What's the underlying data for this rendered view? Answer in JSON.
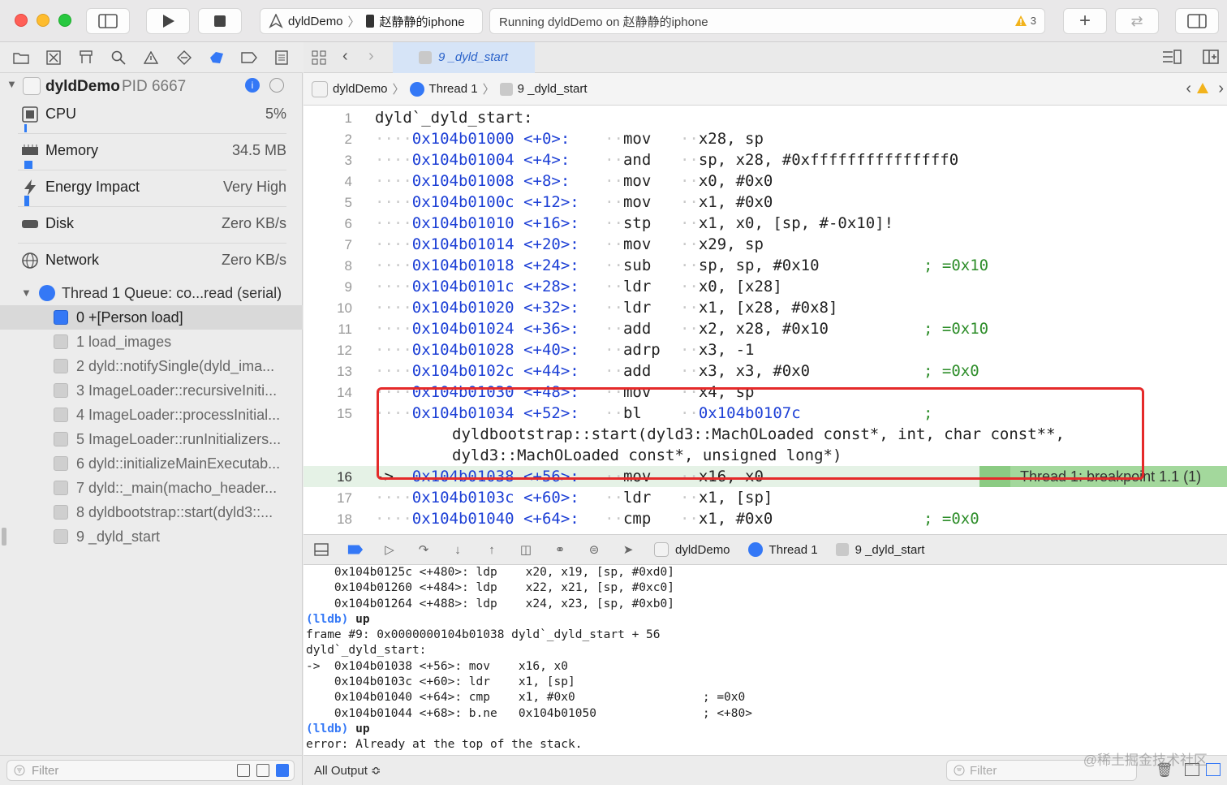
{
  "toolbar": {
    "scheme_project": "dyldDemo",
    "scheme_device": "赵静静的iphone",
    "activity_text": "Running dyldDemo on 赵静静的iphone",
    "warning_count": "3"
  },
  "navigator": {
    "process_name": "dyldDemo",
    "process_pid": "PID 6667",
    "gauges": [
      {
        "label": "CPU",
        "value": "5%"
      },
      {
        "label": "Memory",
        "value": "34.5 MB"
      },
      {
        "label": "Energy Impact",
        "value": "Very High"
      },
      {
        "label": "Disk",
        "value": "Zero KB/s"
      },
      {
        "label": "Network",
        "value": "Zero KB/s"
      }
    ],
    "thread_label": "Thread 1 Queue: co...read (serial)",
    "frames": [
      "0 +[Person load]",
      "1 load_images",
      "2 dyld::notifySingle(dyld_ima...",
      "3 ImageLoader::recursiveIniti...",
      "4 ImageLoader::processInitial...",
      "5 ImageLoader::runInitializers...",
      "6 dyld::initializeMainExecutab...",
      "7 dyld::_main(macho_header...",
      "8 dyldbootstrap::start(dyld3::...",
      "9 _dyld_start"
    ],
    "filter_placeholder": "Filter"
  },
  "editor": {
    "tab_label": "9 _dyld_start",
    "jump": {
      "project": "dyldDemo",
      "thread": "Thread 1",
      "frame": "9 _dyld_start"
    },
    "header": "dyld`_dyld_start:",
    "breakpoint_label": "Thread 1: breakpoint 1.1 (1)",
    "lines": [
      {
        "n": "2",
        "addr": "0x104b01000",
        "off": "<+0>:",
        "op": "mov",
        "args": "x28, sp",
        "cmt": ""
      },
      {
        "n": "3",
        "addr": "0x104b01004",
        "off": "<+4>:",
        "op": "and",
        "args": "sp, x28, #0xfffffffffffffff0",
        "cmt": ""
      },
      {
        "n": "4",
        "addr": "0x104b01008",
        "off": "<+8>:",
        "op": "mov",
        "args": "x0, #0x0",
        "cmt": ""
      },
      {
        "n": "5",
        "addr": "0x104b0100c",
        "off": "<+12>:",
        "op": "mov",
        "args": "x1, #0x0",
        "cmt": ""
      },
      {
        "n": "6",
        "addr": "0x104b01010",
        "off": "<+16>:",
        "op": "stp",
        "args": "x1, x0, [sp, #-0x10]!",
        "cmt": ""
      },
      {
        "n": "7",
        "addr": "0x104b01014",
        "off": "<+20>:",
        "op": "mov",
        "args": "x29, sp",
        "cmt": ""
      },
      {
        "n": "8",
        "addr": "0x104b01018",
        "off": "<+24>:",
        "op": "sub",
        "args": "sp, sp, #0x10",
        "cmt": "; =0x10"
      },
      {
        "n": "9",
        "addr": "0x104b0101c",
        "off": "<+28>:",
        "op": "ldr",
        "args": "x0, [x28]",
        "cmt": ""
      },
      {
        "n": "10",
        "addr": "0x104b01020",
        "off": "<+32>:",
        "op": "ldr",
        "args": "x1, [x28, #0x8]",
        "cmt": ""
      },
      {
        "n": "11",
        "addr": "0x104b01024",
        "off": "<+36>:",
        "op": "add",
        "args": "x2, x28, #0x10",
        "cmt": "; =0x10"
      },
      {
        "n": "12",
        "addr": "0x104b01028",
        "off": "<+40>:",
        "op": "adrp",
        "args": "x3, -1",
        "cmt": ""
      },
      {
        "n": "13",
        "addr": "0x104b0102c",
        "off": "<+44>:",
        "op": "add",
        "args": "x3, x3, #0x0",
        "cmt": "; =0x0"
      },
      {
        "n": "14",
        "addr": "0x104b01030",
        "off": "<+48>:",
        "op": "mov",
        "args": "x4, sp",
        "cmt": ""
      },
      {
        "n": "15",
        "addr": "0x104b01034",
        "off": "<+52>:",
        "op": "bl",
        "args": "0x104b0107c",
        "cmt": ";"
      },
      {
        "n": "",
        "addr": "",
        "off": "",
        "op": "",
        "args": "dyldbootstrap::start(dyld3::MachOLoaded const*, int, char const**,",
        "cmt": ""
      },
      {
        "n": "",
        "addr": "",
        "off": "",
        "op": "",
        "args": "dyld3::MachOLoaded const*, unsigned long*)",
        "cmt": ""
      },
      {
        "n": "16",
        "addr": "0x104b01038",
        "off": "<+56>:",
        "op": "mov",
        "args": "x16, x0",
        "cmt": ""
      },
      {
        "n": "17",
        "addr": "0x104b0103c",
        "off": "<+60>:",
        "op": "ldr",
        "args": "x1, [sp]",
        "cmt": ""
      },
      {
        "n": "18",
        "addr": "0x104b01040",
        "off": "<+64>:",
        "op": "cmp",
        "args": "x1, #0x0",
        "cmt": "; =0x0"
      }
    ]
  },
  "debugbar": {
    "project": "dyldDemo",
    "thread": "Thread 1",
    "frame": "9 _dyld_start"
  },
  "console": {
    "lines": [
      "    0x104b0125c <+480>: ldp    x20, x19, [sp, #0xd0]",
      "    0x104b01260 <+484>: ldp    x22, x21, [sp, #0xc0]",
      "    0x104b01264 <+488>: ldp    x24, x23, [sp, #0xb0]",
      "(lldb) up",
      "frame #9: 0x0000000104b01038 dyld`_dyld_start + 56",
      "dyld`_dyld_start:",
      "->  0x104b01038 <+56>: mov    x16, x0",
      "    0x104b0103c <+60>: ldr    x1, [sp]",
      "    0x104b01040 <+64>: cmp    x1, #0x0                  ; =0x0",
      "    0x104b01044 <+68>: b.ne   0x104b01050               ; <+80>",
      "(lldb) up",
      "error: Already at the top of the stack."
    ],
    "output_selector": "All Output ≎",
    "filter_placeholder": "Filter"
  },
  "watermark": "@稀土掘金技术社区",
  "colors": {
    "accent": "#3478f6",
    "breakpoint": "#a3d89c",
    "highlight_box": "#e52a2a"
  }
}
